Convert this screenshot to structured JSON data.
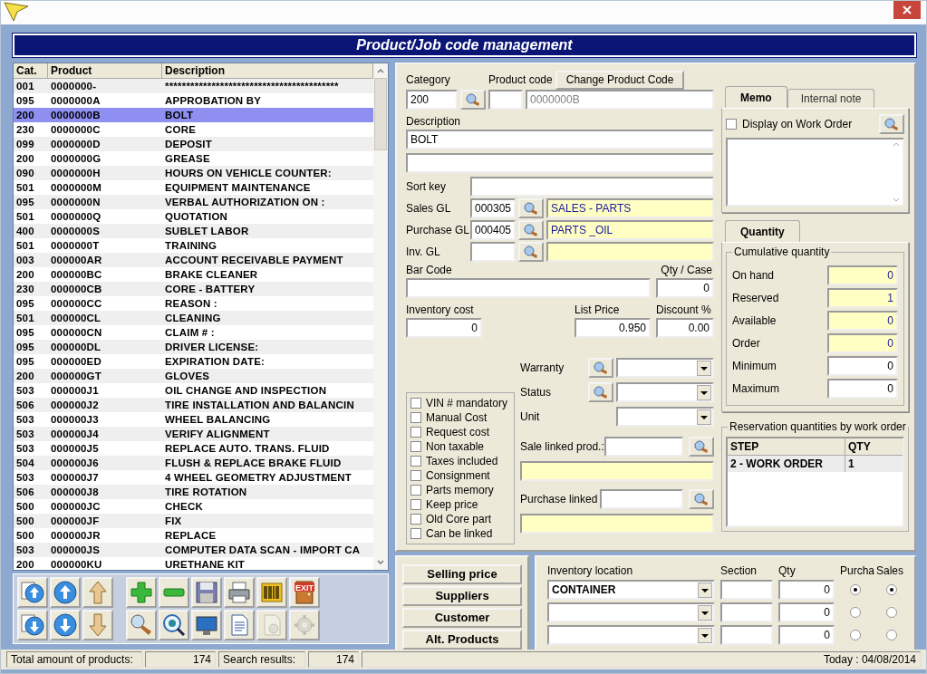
{
  "window": {
    "title": "Product/Job code management"
  },
  "table": {
    "columns": [
      "Cat.",
      "Product",
      "Description"
    ],
    "rows": [
      {
        "cells": [
          "001",
          "0000000-",
          "*****************************************"
        ],
        "selected": false
      },
      {
        "cells": [
          "095",
          "0000000A",
          "APPROBATION BY"
        ],
        "selected": false
      },
      {
        "cells": [
          "200",
          "0000000B",
          "BOLT"
        ],
        "selected": true
      },
      {
        "cells": [
          "230",
          "0000000C",
          "CORE"
        ],
        "selected": false
      },
      {
        "cells": [
          "099",
          "0000000D",
          "DEPOSIT"
        ],
        "selected": false
      },
      {
        "cells": [
          "200",
          "0000000G",
          "GREASE"
        ],
        "selected": false
      },
      {
        "cells": [
          "090",
          "0000000H",
          "HOURS ON VEHICLE COUNTER:"
        ],
        "selected": false
      },
      {
        "cells": [
          "501",
          "0000000M",
          "EQUIPMENT MAINTENANCE"
        ],
        "selected": false
      },
      {
        "cells": [
          "095",
          "0000000N",
          "VERBAL AUTHORIZATION ON :"
        ],
        "selected": false
      },
      {
        "cells": [
          "501",
          "0000000Q",
          "QUOTATION"
        ],
        "selected": false
      },
      {
        "cells": [
          "400",
          "0000000S",
          "SUBLET LABOR"
        ],
        "selected": false
      },
      {
        "cells": [
          "501",
          "0000000T",
          "TRAINING"
        ],
        "selected": false
      },
      {
        "cells": [
          "003",
          "000000AR",
          "ACCOUNT RECEIVABLE PAYMENT"
        ],
        "selected": false
      },
      {
        "cells": [
          "200",
          "000000BC",
          "BRAKE CLEANER"
        ],
        "selected": false
      },
      {
        "cells": [
          "230",
          "000000CB",
          "CORE - BATTERY"
        ],
        "selected": false
      },
      {
        "cells": [
          "095",
          "000000CC",
          "REASON :"
        ],
        "selected": false
      },
      {
        "cells": [
          "501",
          "000000CL",
          "CLEANING"
        ],
        "selected": false
      },
      {
        "cells": [
          "095",
          "000000CN",
          "CLAIM # :"
        ],
        "selected": false
      },
      {
        "cells": [
          "095",
          "000000DL",
          "DRIVER LICENSE:"
        ],
        "selected": false
      },
      {
        "cells": [
          "095",
          "000000ED",
          "EXPIRATION DATE:"
        ],
        "selected": false
      },
      {
        "cells": [
          "200",
          "000000GT",
          "GLOVES"
        ],
        "selected": false
      },
      {
        "cells": [
          "503",
          "000000J1",
          "OIL CHANGE AND INSPECTION"
        ],
        "selected": false
      },
      {
        "cells": [
          "506",
          "000000J2",
          "TIRE INSTALLATION AND BALANCIN"
        ],
        "selected": false
      },
      {
        "cells": [
          "503",
          "000000J3",
          "WHEEL BALANCING"
        ],
        "selected": false
      },
      {
        "cells": [
          "503",
          "000000J4",
          "VERIFY ALIGNMENT"
        ],
        "selected": false
      },
      {
        "cells": [
          "503",
          "000000J5",
          "REPLACE AUTO. TRANS. FLUID"
        ],
        "selected": false
      },
      {
        "cells": [
          "504",
          "000000J6",
          "FLUSH & REPLACE BRAKE FLUID"
        ],
        "selected": false
      },
      {
        "cells": [
          "503",
          "000000J7",
          "4 WHEEL GEOMETRY ADJUSTMENT"
        ],
        "selected": false
      },
      {
        "cells": [
          "506",
          "000000J8",
          "TIRE ROTATION"
        ],
        "selected": false
      },
      {
        "cells": [
          "500",
          "000000JC",
          "CHECK"
        ],
        "selected": false
      },
      {
        "cells": [
          "500",
          "000000JF",
          "FIX"
        ],
        "selected": false
      },
      {
        "cells": [
          "500",
          "000000JR",
          "REPLACE"
        ],
        "selected": false
      },
      {
        "cells": [
          "503",
          "000000JS",
          "COMPUTER DATA SCAN - IMPORT CA"
        ],
        "selected": false
      },
      {
        "cells": [
          "200",
          "000000KU",
          "URETHANE KIT"
        ],
        "selected": false
      }
    ]
  },
  "toolbar": {
    "nav": [
      {
        "disabled": false
      },
      {
        "disabled": false
      },
      {
        "disabled": false
      },
      {
        "disabled": false
      },
      {
        "disabled": false
      },
      {
        "disabled": false
      }
    ],
    "actions": [
      {
        "disabled": false
      },
      {
        "disabled": false
      },
      {
        "disabled": false
      },
      {
        "disabled": false
      },
      {
        "disabled": false
      },
      {
        "disabled": false,
        "label": "EXIT"
      },
      {
        "disabled": false
      },
      {
        "disabled": false
      },
      {
        "disabled": false
      },
      {
        "disabled": false
      },
      {
        "disabled": true
      },
      {
        "disabled": true
      }
    ]
  },
  "form": {
    "category": {
      "label": "Category",
      "value": "200"
    },
    "product_code": {
      "label": "Product code",
      "value": "0000000B"
    },
    "change_code_button": "Change Product Code",
    "description": {
      "label": "Description",
      "value": "BOLT"
    },
    "sort_key": {
      "label": "Sort key"
    },
    "gl_accounts": [
      {
        "label": "Sales GL",
        "code": "000305",
        "name": "SALES - PARTS"
      },
      {
        "label": "Purchase GL",
        "code": "000405",
        "name": "PARTS _OIL"
      },
      {
        "label": "Inv. GL"
      }
    ],
    "bar_code": {
      "label": "Bar Code"
    },
    "qty_case": {
      "label": "Qty / Case",
      "value": "0"
    },
    "inventory_cost": {
      "label": "Inventory cost",
      "value": "0"
    },
    "list_price": {
      "label": "List Price",
      "value": "0.950"
    },
    "discount": {
      "label": "Discount %",
      "value": "0.00"
    },
    "flags": [
      {
        "label": "VIN # mandatory",
        "checked": false
      },
      {
        "label": "Manual Cost",
        "checked": false
      },
      {
        "label": "Request cost",
        "checked": false
      },
      {
        "label": "Non taxable",
        "checked": false
      },
      {
        "label": "Taxes included",
        "checked": false
      },
      {
        "label": "Consignment",
        "checked": false
      },
      {
        "label": "Parts memory",
        "checked": false
      },
      {
        "label": "Keep price",
        "checked": false
      },
      {
        "label": "Old Core part",
        "checked": false
      },
      {
        "label": "Can be linked",
        "checked": false
      }
    ],
    "selectors": [
      {
        "label": "Warranty",
        "lookup": true
      },
      {
        "label": "Status",
        "lookup": true
      },
      {
        "label": "Unit",
        "lookup": false
      }
    ],
    "linked": [
      {
        "label": "Sale linked prod.:"
      },
      {
        "label": "Purchase linked"
      }
    ]
  },
  "notes": {
    "tabs": [
      {
        "label": "Memo",
        "selected": true
      },
      {
        "label": "Internal note",
        "selected": false
      }
    ],
    "display_on_work_order": {
      "label": "Display on Work Order",
      "checked": false
    }
  },
  "quantity": {
    "tab": "Quantity",
    "group": "Cumulative quantity",
    "fields": [
      {
        "label": "On hand",
        "value": "0",
        "computed": true
      },
      {
        "label": "Reserved",
        "value": "1",
        "computed": true
      },
      {
        "label": "Available",
        "value": "0",
        "computed": true
      },
      {
        "label": "Order",
        "value": "0",
        "computed": true
      },
      {
        "label": "Minimum",
        "value": "0",
        "computed": false
      },
      {
        "label": "Maximum",
        "value": "0",
        "computed": false
      }
    ]
  },
  "reservations": {
    "title": "Reservation quantities by work order",
    "columns": [
      "STEP",
      "QTY"
    ],
    "rows": [
      [
        "2 - WORK ORDER",
        "1"
      ]
    ]
  },
  "price_buttons": [
    "Selling price",
    "Suppliers",
    "Customer",
    "Alt. Products"
  ],
  "inventory": {
    "columns": [
      "Inventory location",
      "Section",
      "Qty",
      "Purcha",
      "Sales"
    ],
    "rows": [
      {
        "location": "CONTAINER",
        "qty": "0",
        "purchase_selected": true,
        "sales_selected": true
      },
      {
        "qty": "0",
        "purchase_selected": false,
        "sales_selected": false
      },
      {
        "qty": "0",
        "purchase_selected": false,
        "sales_selected": false
      }
    ]
  },
  "status_bar": {
    "total_label": "Total amount of products:",
    "total": "174",
    "search_label": "Search results:",
    "search": "174",
    "today": "Today : 04/08/2014"
  }
}
